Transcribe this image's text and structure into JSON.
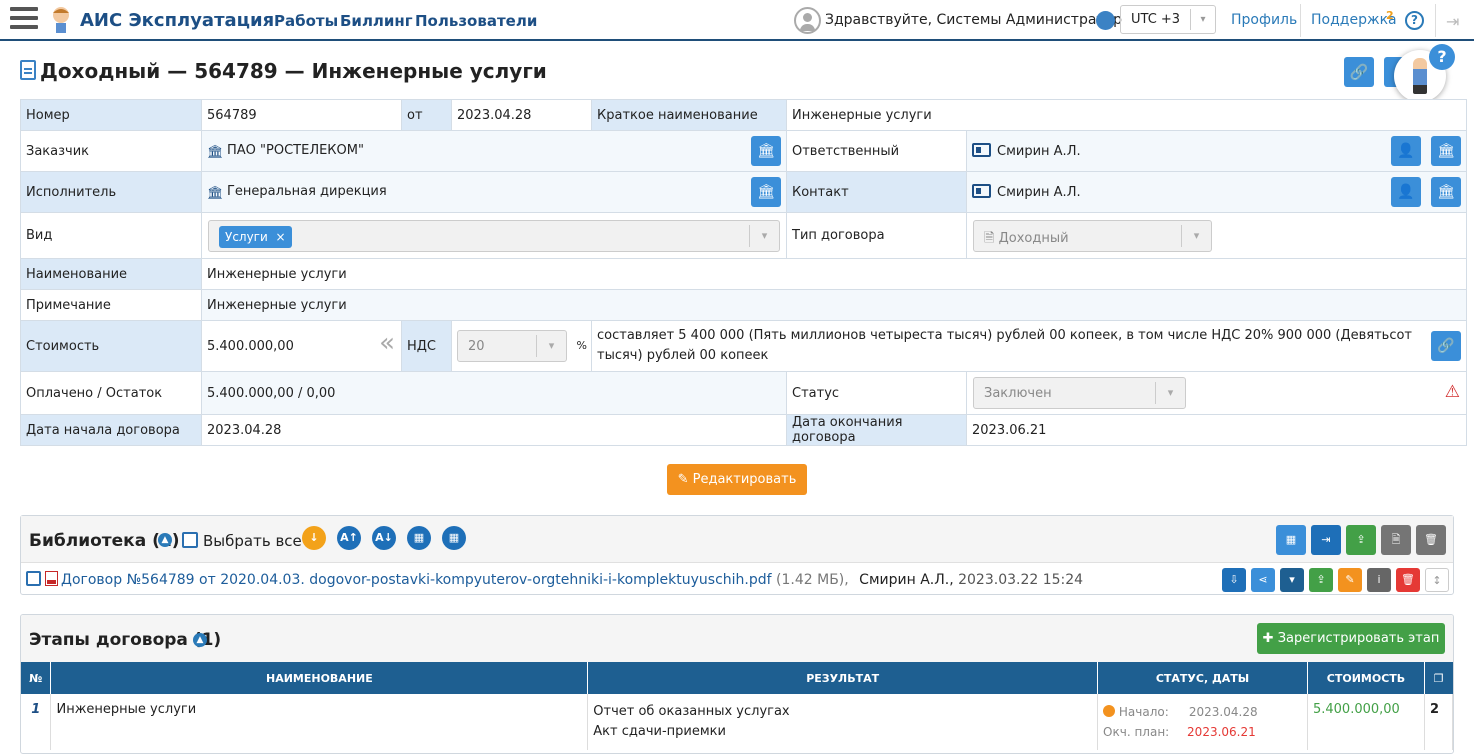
{
  "app": {
    "name": "АИС Эксплуатация"
  },
  "nav": [
    {
      "label": "Работы"
    },
    {
      "label": "Биллинг"
    },
    {
      "label": "Пользователи"
    }
  ],
  "header": {
    "greeting": "Здравствуйте, Системы Администратор",
    "timezone": "UTC +3",
    "profile": "Профиль",
    "support": "Поддержка",
    "support_count": "2",
    "help": "?"
  },
  "page": {
    "title": "Доходный — 564789 — Инженерные услуги"
  },
  "form": {
    "number_label": "Номер",
    "number": "564789",
    "from_label": "от",
    "date": "2023.04.28",
    "short_name_label": "Краткое наименование",
    "short_name": "Инженерные услуги",
    "customer_label": "Заказчик",
    "customer": "ПАО \"РОСТЕЛЕКОМ\"",
    "responsible_label": "Ответственный",
    "responsible": "Смирин А.Л.",
    "executor_label": "Исполнитель",
    "executor": "Генеральная дирекция",
    "contact_label": "Контакт",
    "contact": "Смирин А.Л.",
    "kind_label": "Вид",
    "kind_tag": "Услуги",
    "kind_tag_remove": "×",
    "contract_type_label": "Тип договора",
    "contract_type": "Доходный",
    "name_label": "Наименование",
    "name": "Инженерные услуги",
    "note_label": "Примечание",
    "note": "Инженерные услуги",
    "cost_label": "Стоимость",
    "cost": "5.400.000,00",
    "vat_label": "НДС",
    "vat": "20",
    "vat_unit": "%",
    "cost_words": "составляет 5 400 000 (Пять миллионов четыреста тысяч) рублей 00 копеек, в том числе НДС 20% 900 000 (Девятьсот тысяч) рублей 00 копеек",
    "paid_label": "Оплачено / Остаток",
    "paid": "5.400.000,00 / 0,00",
    "status_label": "Статус",
    "status": "Заключен",
    "start_label": "Дата начала договора",
    "start": "2023.04.28",
    "end_label": "Дата окончания договора",
    "end": "2023.06.21"
  },
  "edit_button": "Редактировать",
  "library": {
    "title": "Библиотека (1)",
    "select_all": "Выбрать все",
    "file": {
      "name": "Договор №564789 от 2020.04.03. dogovor-postavki-kompyuterov-orgtehniki-i-komplektuyuschih.pdf",
      "size": "(1.42 МБ),",
      "author": "Смирин А.Л.,",
      "date": "2023.03.22 15:24"
    }
  },
  "stages": {
    "title": "Этапы договора (1)",
    "register_button": "Зарегистрировать этап",
    "columns": [
      "№",
      "НАИМЕНОВАНИЕ",
      "РЕЗУЛЬТАТ",
      "СТАТУС, ДАТЫ",
      "СТОИМОСТЬ"
    ],
    "rows": [
      {
        "num": "1",
        "name": "Инженерные услуги",
        "result1": "Отчет об оказанных услугах",
        "result2": "Акт сдачи-приемки",
        "start_label": "Начало:",
        "start": "2023.04.28",
        "end_label": "Окч. план:",
        "end": "2023.06.21",
        "cost": "5.400.000,00",
        "count": "2"
      }
    ]
  }
}
